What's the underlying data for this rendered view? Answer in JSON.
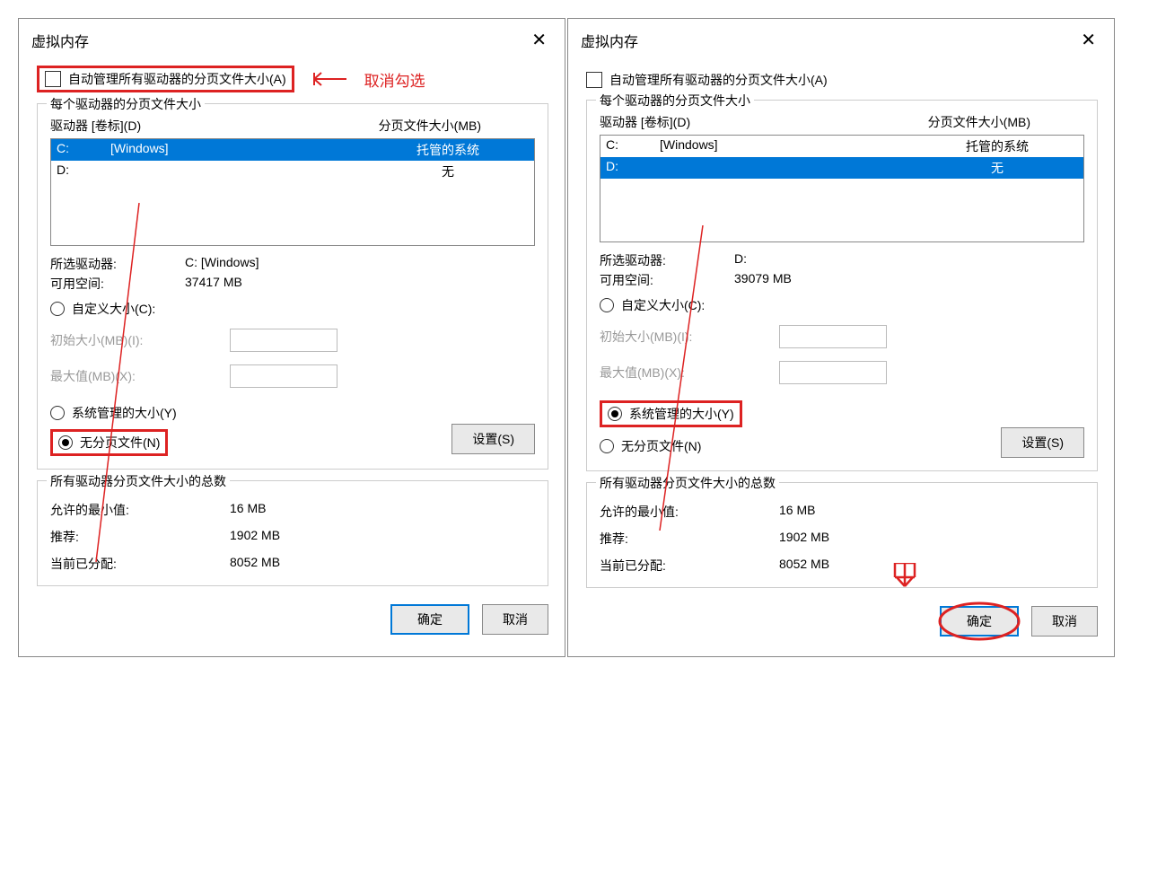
{
  "annotations": {
    "uncheck_label": "取消勾选"
  },
  "left": {
    "title": "虚拟内存",
    "auto_manage_label": "自动管理所有驱动器的分页文件大小(A)",
    "group1_legend": "每个驱动器的分页文件大小",
    "list_head_drive": "驱动器 [卷标](D)",
    "list_head_size": "分页文件大小(MB)",
    "drives": [
      {
        "drv": "C:",
        "label": "[Windows]",
        "size": "托管的系统",
        "selected": true
      },
      {
        "drv": "D:",
        "label": "",
        "size": "无",
        "selected": false
      }
    ],
    "sel_drive_label": "所选驱动器:",
    "sel_drive_value": "C:  [Windows]",
    "free_label": "可用空间:",
    "free_value": "37417 MB",
    "radio_custom": "自定义大小(C):",
    "init_label": "初始大小(MB)(I):",
    "max_label": "最大值(MB)(X):",
    "radio_sys": "系统管理的大小(Y)",
    "radio_none": "无分页文件(N)",
    "radio_checked": "none",
    "set_btn": "设置(S)",
    "group2_legend": "所有驱动器分页文件大小的总数",
    "min_label": "允许的最小值:",
    "min_value": "16 MB",
    "rec_label": "推荐:",
    "rec_value": "1902 MB",
    "cur_label": "当前已分配:",
    "cur_value": "8052 MB",
    "ok": "确定",
    "cancel": "取消"
  },
  "right": {
    "title": "虚拟内存",
    "auto_manage_label": "自动管理所有驱动器的分页文件大小(A)",
    "group1_legend": "每个驱动器的分页文件大小",
    "list_head_drive": "驱动器 [卷标](D)",
    "list_head_size": "分页文件大小(MB)",
    "drives": [
      {
        "drv": "C:",
        "label": "[Windows]",
        "size": "托管的系统",
        "selected": false
      },
      {
        "drv": "D:",
        "label": "",
        "size": "无",
        "selected": true
      }
    ],
    "sel_drive_label": "所选驱动器:",
    "sel_drive_value": "D:",
    "free_label": "可用空间:",
    "free_value": "39079 MB",
    "radio_custom": "自定义大小(C):",
    "init_label": "初始大小(MB)(I):",
    "max_label": "最大值(MB)(X):",
    "radio_sys": "系统管理的大小(Y)",
    "radio_none": "无分页文件(N)",
    "radio_checked": "sys",
    "set_btn": "设置(S)",
    "group2_legend": "所有驱动器分页文件大小的总数",
    "min_label": "允许的最小值:",
    "min_value": "16 MB",
    "rec_label": "推荐:",
    "rec_value": "1902 MB",
    "cur_label": "当前已分配:",
    "cur_value": "8052 MB",
    "ok": "确定",
    "cancel": "取消"
  }
}
